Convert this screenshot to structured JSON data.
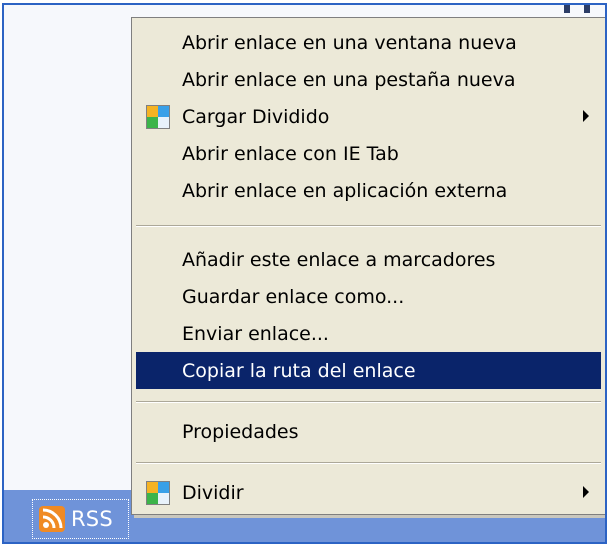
{
  "bottom_bar": {
    "rss_label": "RSS"
  },
  "context_menu": {
    "items": [
      {
        "label": "Abrir enlace en una ventana nueva"
      },
      {
        "label": "Abrir enlace en una pestaña nueva"
      },
      {
        "label": "Cargar Dividido",
        "icon": "split-view-icon",
        "submenu": true
      },
      {
        "label": "Abrir enlace con IE Tab"
      },
      {
        "label": "Abrir enlace en aplicación externa"
      },
      {
        "label": "Añadir este enlace a marcadores"
      },
      {
        "label": "Guardar enlace como..."
      },
      {
        "label": "Enviar enlace..."
      },
      {
        "label": "Copiar la ruta del enlace",
        "highlighted": true
      },
      {
        "label": "Propiedades"
      },
      {
        "label": "Dividir",
        "icon": "split-view-icon",
        "submenu": true
      }
    ]
  },
  "colors": {
    "menu_background": "#ece9d8",
    "highlight": "#0a246a",
    "taskbar": "#6f93d9",
    "frame_border": "#2c63c4"
  }
}
